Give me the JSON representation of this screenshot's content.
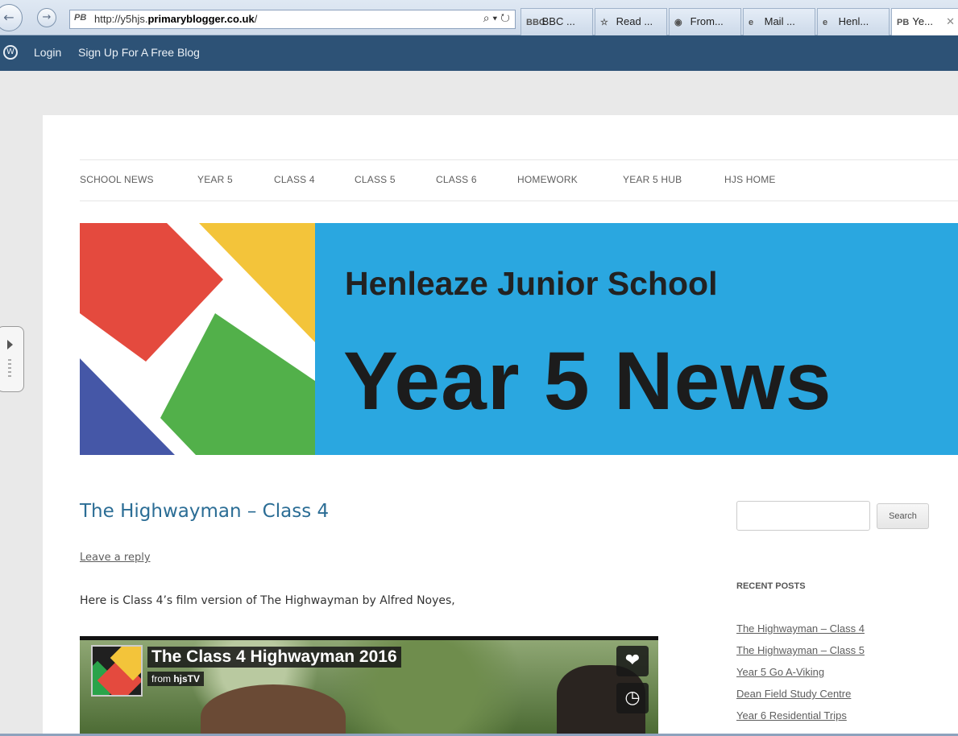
{
  "browser": {
    "url_prefix": "http://y5hjs.",
    "url_domain": "primaryblogger.co.uk",
    "url_suffix": "/",
    "address_favicon": "PB",
    "address_tools": "⌕ ▾ ↻",
    "tabs": [
      {
        "icon": "BBC",
        "label": "BBC ..."
      },
      {
        "icon": "☆",
        "label": "Read ..."
      },
      {
        "icon": "◉",
        "label": "From..."
      },
      {
        "icon": "e",
        "label": "Mail ..."
      },
      {
        "icon": "e",
        "label": "Henl..."
      },
      {
        "icon": "PB",
        "label": "Ye...",
        "close": "✕"
      }
    ]
  },
  "admin_bar": {
    "wp_icon": "W",
    "login": "Login",
    "signup": "Sign Up For A Free Blog"
  },
  "nav": {
    "items": [
      "SCHOOL NEWS",
      "YEAR 5",
      "CLASS 4",
      "CLASS 5",
      "CLASS 6",
      "HOMEWORK",
      "YEAR 5 HUB",
      "HJS HOME"
    ]
  },
  "banner": {
    "school": "Henleaze Junior School",
    "title": "Year 5 News"
  },
  "post": {
    "title": "The Highwayman – Class 4",
    "leave_reply": "Leave a reply",
    "text": "Here is Class 4’s film version of The Highwayman by Alfred Noyes,",
    "video": {
      "title": "The Class 4 Highwayman 2016",
      "from_prefix": "from ",
      "from_channel": "hjsTV",
      "like_icon": "❤",
      "later_icon": "◷"
    }
  },
  "sidebar": {
    "search_button": "Search",
    "recent_heading": "RECENT POSTS",
    "recent_posts": [
      "The Highwayman – Class 4",
      "The Highwayman – Class 5",
      "Year 5 Go A-Viking",
      "Dean Field Study Centre",
      "Year 6 Residential Trips"
    ]
  },
  "colors": {
    "admin_bar": "#2d5276",
    "banner_blue": "#2aa7e0",
    "post_title": "#2b6d95"
  }
}
